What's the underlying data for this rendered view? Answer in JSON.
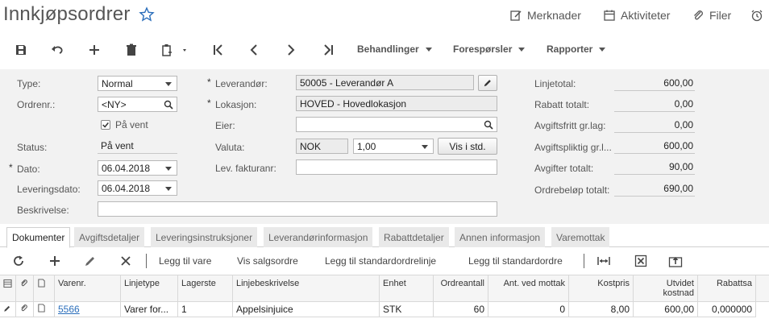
{
  "header": {
    "title": "Innkjøpsordrer",
    "actions": [
      "Merknader",
      "Aktiviteter",
      "Filer"
    ]
  },
  "toolbar": {
    "menus": [
      "Behandlinger",
      "Forespørsler",
      "Rapporter"
    ]
  },
  "form": {
    "type_label": "Type:",
    "type_value": "Normal",
    "ordrenr_label": "Ordrenr.:",
    "ordrenr_value": "<NY>",
    "paa_vent_checkbox_label": "På vent",
    "status_label": "Status:",
    "status_value": "På vent",
    "dato_label": "Dato:",
    "dato_value": "06.04.2018",
    "leveringsdato_label": "Leveringsdato:",
    "leveringsdato_value": "06.04.2018",
    "beskrivelse_label": "Beskrivelse:",
    "beskrivelse_value": "",
    "leverandor_label": "Leverandør:",
    "leverandor_value": "50005 - Leverandør A",
    "lokasjon_label": "Lokasjon:",
    "lokasjon_value": "HOVED - Hovedlokasjon",
    "eier_label": "Eier:",
    "eier_value": "",
    "valuta_label": "Valuta:",
    "valuta_value": "NOK",
    "valuta_rate": "1,00",
    "vis_i_std_label": "Vis i std.",
    "lev_fakturanr_label": "Lev. fakturanr:",
    "lev_fakturanr_value": ""
  },
  "totals": [
    {
      "label": "Linjetotal:",
      "value": "600,00"
    },
    {
      "label": "Rabatt totalt:",
      "value": "0,00"
    },
    {
      "label": "Avgiftsfritt gr.lag:",
      "value": "0,00"
    },
    {
      "label": "Avgiftspliktig gr.l...",
      "value": "600,00"
    },
    {
      "label": "Avgifter totalt:",
      "value": "90,00"
    },
    {
      "label": "Ordrebeløp totalt:",
      "value": "690,00"
    }
  ],
  "tabs": [
    "Dokumenter",
    "Avgiftsdetaljer",
    "Leveringsinstruksjoner",
    "Leverandørinformasjon",
    "Rabattdetaljer",
    "Annen informasjon",
    "Varemottak"
  ],
  "grid_toolbar": {
    "buttons": [
      "Legg til vare",
      "Vis salgsordre",
      "Legg til standardordrelinje",
      "Legg til standardordre"
    ]
  },
  "grid": {
    "columns": [
      "Varenr.",
      "Linjetype",
      "Lagerste",
      "Linjebeskrivelse",
      "Enhet",
      "Ordreantall",
      "Ant. ved mottak",
      "Kostpris",
      "Utvidet kostnad",
      "Rabattsa"
    ],
    "rows": [
      {
        "varenr": "5566",
        "linjetype": "Varer for...",
        "lagersted": "1",
        "beskrivelse": "Appelsinjuice",
        "enhet": "STK",
        "ordreantall": "60",
        "ant_mottak": "0",
        "kostpris": "8,00",
        "utvidet": "600,00",
        "rabatt": "0,000000"
      }
    ]
  },
  "colors": {
    "accent": "#2a6ebb",
    "form_bg": "#f2f2f2"
  }
}
